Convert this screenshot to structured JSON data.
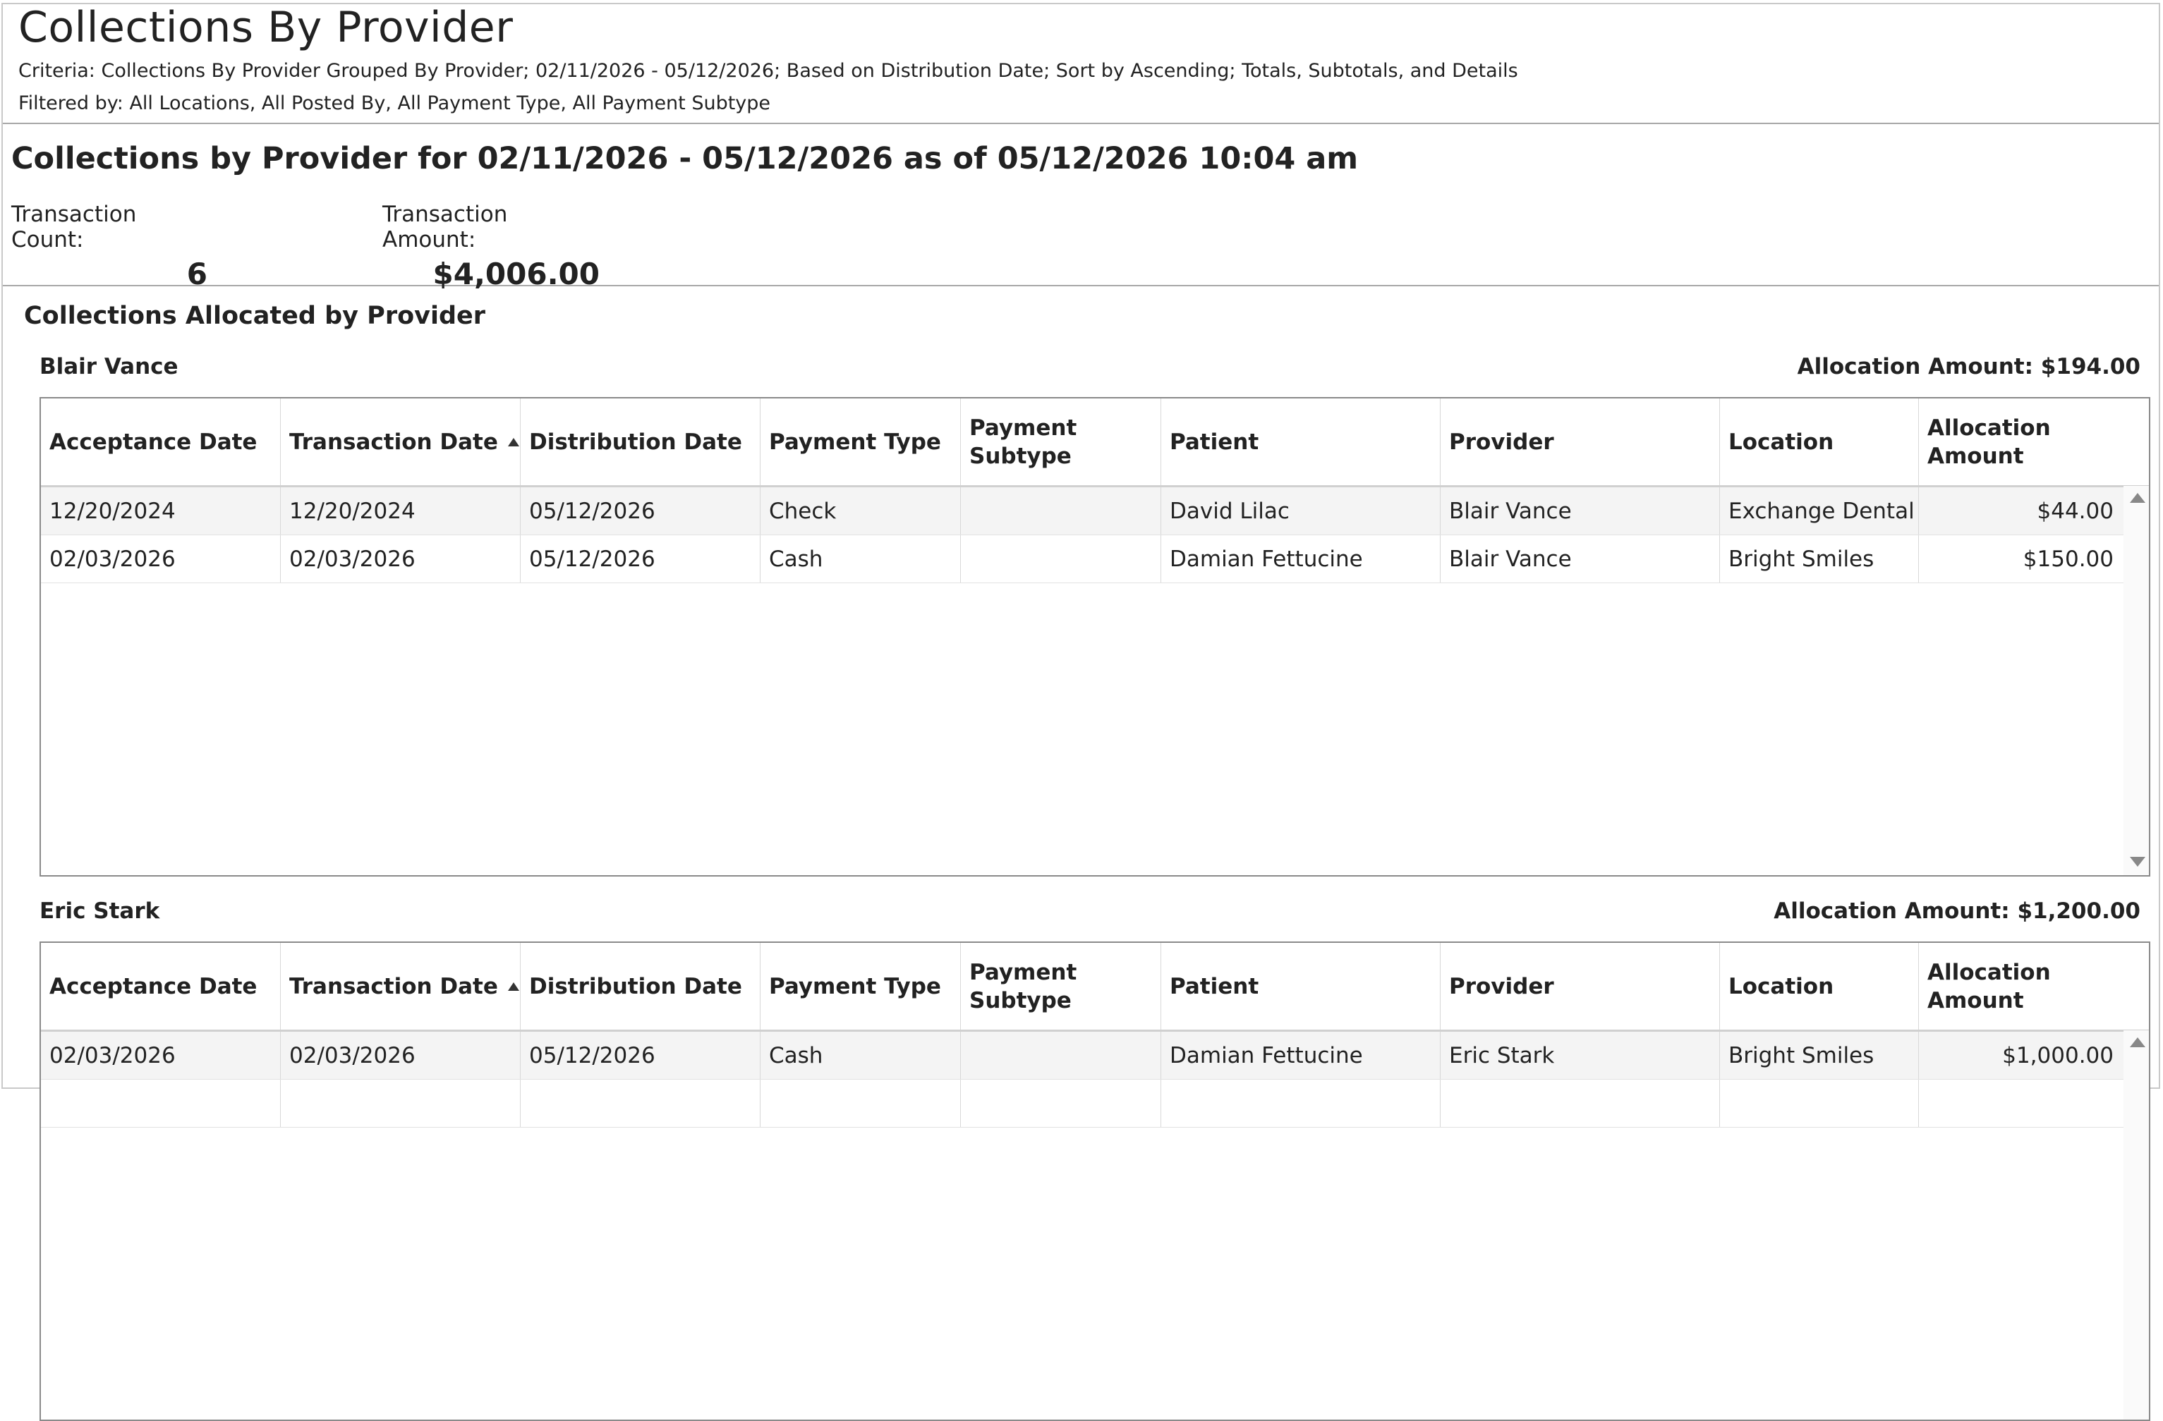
{
  "report": {
    "title": "Collections By Provider",
    "criteria": "Criteria: Collections By Provider Grouped By Provider; 02/11/2026 - 05/12/2026; Based on Distribution Date; Sort by Ascending; Totals, Subtotals, and Details",
    "filters": "Filtered by: All Locations, All Posted By, All Payment Type, All Payment Subtype"
  },
  "summary": {
    "title": "Collections by Provider for 02/11/2026 - 05/12/2026 as of 05/12/2026 10:04 am",
    "count_label": "Transaction Count:",
    "count_value": "6",
    "amount_label": "Transaction Amount:",
    "amount_value": "$4,006.00"
  },
  "section_title": "Collections Allocated by Provider",
  "columns": [
    "Acceptance Date",
    "Transaction Date",
    "Distribution Date",
    "Payment Type",
    "Payment Subtype",
    "Patient",
    "Provider",
    "Location",
    "Allocation Amount"
  ],
  "sort": {
    "column": "Transaction Date",
    "direction": "ascending"
  },
  "groups": [
    {
      "name": "Blair Vance",
      "allocation": "Allocation Amount: $194.00",
      "rows": [
        [
          "12/20/2024",
          "12/20/2024",
          "05/12/2026",
          "Check",
          "",
          "David Lilac",
          "Blair Vance",
          "Exchange Dental",
          "$44.00"
        ],
        [
          "02/03/2026",
          "02/03/2026",
          "05/12/2026",
          "Cash",
          "",
          "Damian Fettucine",
          "Blair Vance",
          "Bright Smiles",
          "$150.00"
        ]
      ]
    },
    {
      "name": "Eric Stark",
      "allocation": "Allocation Amount: $1,200.00",
      "rows": [
        [
          "02/03/2026",
          "02/03/2026",
          "05/12/2026",
          "Cash",
          "",
          "Damian Fettucine",
          "Eric Stark",
          "Bright Smiles",
          "$1,000.00"
        ]
      ]
    }
  ],
  "icons": [
    "sort-ascending-icon",
    "scroll-up-icon",
    "scroll-down-icon"
  ]
}
